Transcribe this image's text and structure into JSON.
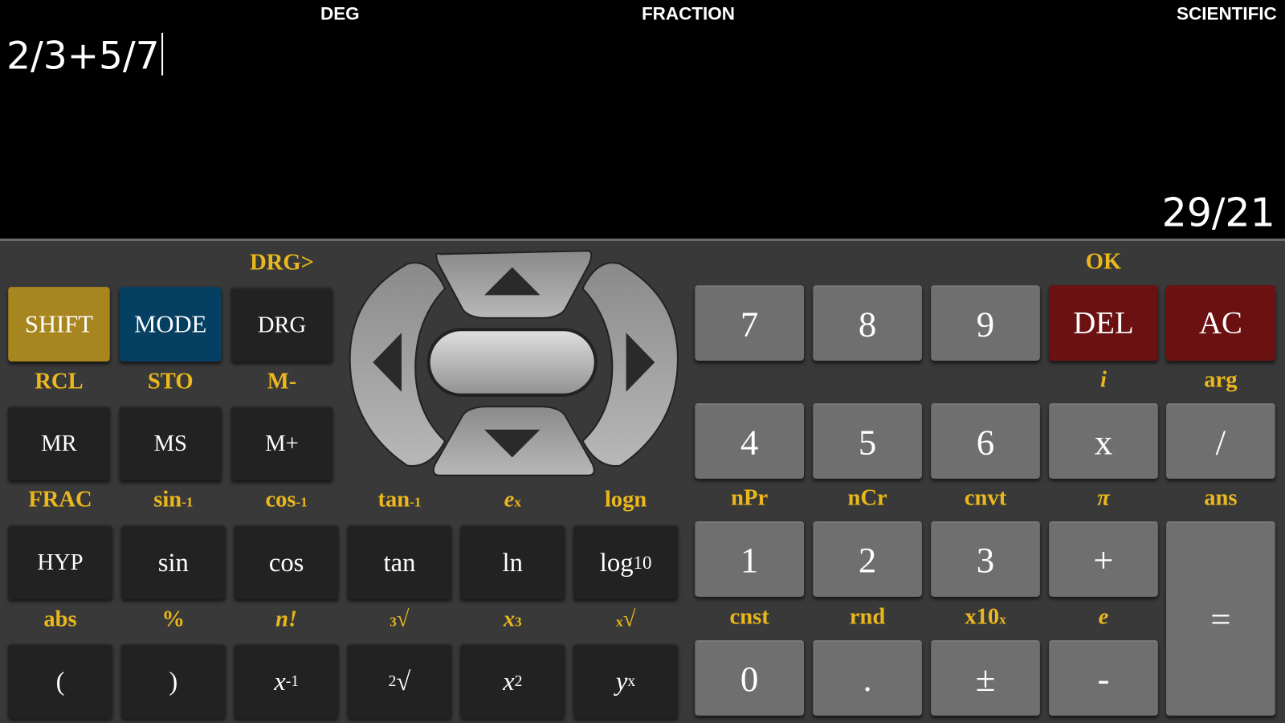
{
  "display": {
    "angle_mode": "DEG",
    "output_mode": "FRACTION",
    "calc_mode": "SCIENTIFIC",
    "expression": "2/3+5/7",
    "result": "29/21"
  },
  "colors": {
    "shift": "#a8861f",
    "mode": "#053f62",
    "dark_key": "#222222",
    "digit_key": "#6f6f6f",
    "delete_key": "#6b1111",
    "secondary_label": "#eab71c",
    "panel": "#393939"
  },
  "dpad": {
    "up": "arrow-up-icon",
    "down": "arrow-down-icon",
    "left": "arrow-left-icon",
    "right": "arrow-right-icon",
    "center": "ok-pill"
  },
  "left_keys": [
    {
      "name": "shift",
      "label": "SHIFT",
      "style": "gold",
      "shift": ""
    },
    {
      "name": "mode",
      "label": "MODE",
      "style": "blue",
      "shift": ""
    },
    {
      "name": "drg",
      "label": "DRG",
      "style": "dark sm",
      "shift": "DRG>"
    },
    {
      "name": "mr",
      "label": "MR",
      "style": "dark sm",
      "shift": "RCL"
    },
    {
      "name": "ms",
      "label": "MS",
      "style": "dark sm",
      "shift": "STO"
    },
    {
      "name": "m-plus",
      "label": "M+",
      "style": "dark sm",
      "shift": "M-"
    }
  ],
  "func_keys": [
    {
      "name": "hyp",
      "label": "HYP",
      "style": "dark sm",
      "shift": "FRAC"
    },
    {
      "name": "sin",
      "label": "sin",
      "style": "dark",
      "shift": "sin",
      "shift_sup": "-1"
    },
    {
      "name": "cos",
      "label": "cos",
      "style": "dark",
      "shift": "cos",
      "shift_sup": "-1"
    },
    {
      "name": "tan",
      "label": "tan",
      "style": "dark",
      "shift": "tan",
      "shift_sup": "-1"
    },
    {
      "name": "ln",
      "label": "ln",
      "style": "dark",
      "shift": "e",
      "shift_sup": "x",
      "shift_italic": true
    },
    {
      "name": "log10",
      "label": "log",
      "sub": "10",
      "style": "dark",
      "shift": "logn"
    },
    {
      "name": "open-paren",
      "label": "(",
      "style": "dark",
      "shift": "abs"
    },
    {
      "name": "close-paren",
      "label": ")",
      "style": "dark",
      "shift": "%"
    },
    {
      "name": "reciprocal",
      "label": "x",
      "sup": "-1",
      "italic": true,
      "style": "dark",
      "shift": "n!",
      "shift_italic": true
    },
    {
      "name": "sqrt",
      "pre": "2",
      "label": "√",
      "style": "dark",
      "shift": "√",
      "shift_pre": "3"
    },
    {
      "name": "square",
      "label": "x",
      "sup": "2",
      "italic": true,
      "style": "dark",
      "shift": "x",
      "shift_sup": "3",
      "shift_italic": true
    },
    {
      "name": "power",
      "label": "y",
      "sup": "x",
      "italic": true,
      "style": "dark",
      "shift": "√",
      "shift_pre": "x",
      "shift_italic": true
    }
  ],
  "num_keys": [
    {
      "name": "7",
      "label": "7",
      "style": "grey",
      "shift": ""
    },
    {
      "name": "8",
      "label": "8",
      "style": "grey",
      "shift": ""
    },
    {
      "name": "9",
      "label": "9",
      "style": "grey",
      "shift": ""
    },
    {
      "name": "del",
      "label": "DEL",
      "style": "red",
      "shift": "OK"
    },
    {
      "name": "ac",
      "label": "AC",
      "style": "red",
      "shift": ""
    },
    {
      "name": "4",
      "label": "4",
      "style": "grey",
      "shift": ""
    },
    {
      "name": "5",
      "label": "5",
      "style": "grey",
      "shift": ""
    },
    {
      "name": "6",
      "label": "6",
      "style": "grey",
      "shift": ""
    },
    {
      "name": "multiply",
      "label": "x",
      "style": "grey",
      "shift": "i",
      "shift_italic": true
    },
    {
      "name": "divide",
      "label": "/",
      "style": "grey",
      "shift": "arg"
    },
    {
      "name": "1",
      "label": "1",
      "style": "grey",
      "shift": "nPr"
    },
    {
      "name": "2",
      "label": "2",
      "style": "grey",
      "shift": "nCr"
    },
    {
      "name": "3",
      "label": "3",
      "style": "grey",
      "shift": "cnvt"
    },
    {
      "name": "plus",
      "label": "+",
      "style": "grey",
      "shift": "π",
      "shift_italic": true
    },
    {
      "name": "equals",
      "label": "=",
      "style": "grey",
      "shift": "ans"
    },
    {
      "name": "0",
      "label": "0",
      "style": "grey",
      "shift": "cnst"
    },
    {
      "name": "decimal",
      "label": ".",
      "style": "grey",
      "shift": "rnd"
    },
    {
      "name": "negate",
      "label": "±",
      "style": "grey",
      "shift": "x10",
      "shift_sup": "x"
    },
    {
      "name": "minus",
      "label": "-",
      "style": "grey",
      "shift": "e",
      "shift_italic": true
    }
  ]
}
